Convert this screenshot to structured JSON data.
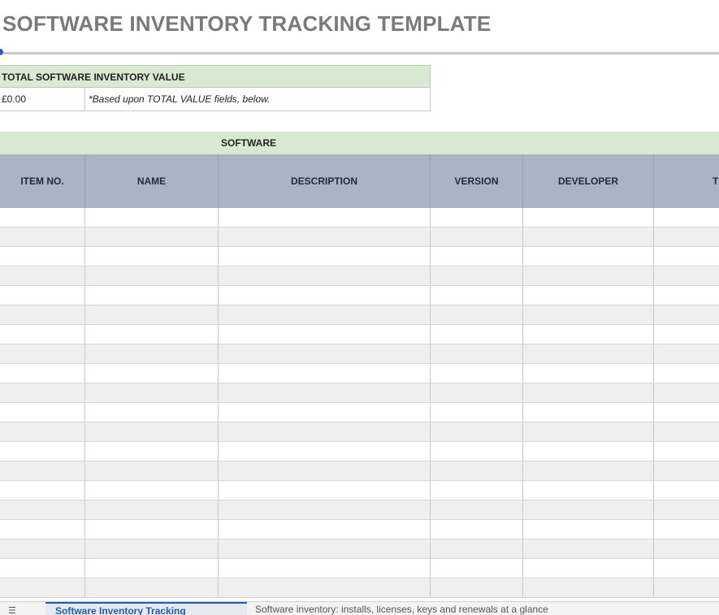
{
  "header": {
    "title": "SOFTWARE INVENTORY TRACKING TEMPLATE"
  },
  "total": {
    "label": "TOTAL SOFTWARE INVENTORY VALUE",
    "value": "£0.00",
    "note": "*Based upon TOTAL VALUE fields, below."
  },
  "software": {
    "section_label": "SOFTWARE",
    "columns": [
      "ITEM NO.",
      "NAME",
      "DESCRIPTION",
      "VERSION",
      "DEVELOPER",
      "TY"
    ],
    "row_count": 20
  },
  "tabbar": {
    "menu_icon": "hamburger-menu-icon",
    "active_tab": "Software Inventory Tracking",
    "description": "Software inventory: installs, licenses, keys and renewals at a glance"
  },
  "colors": {
    "accent_green": "#d9ead3",
    "header_blue_gray": "#aab4c5",
    "tab_blue": "#1a5fb4"
  }
}
